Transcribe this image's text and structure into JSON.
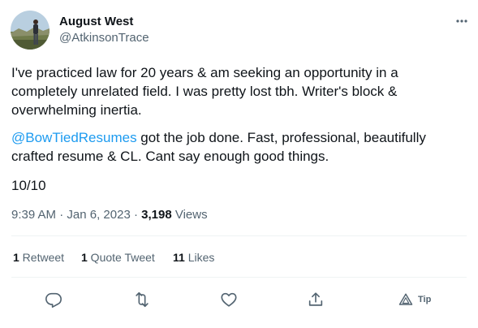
{
  "author": {
    "name": "August West",
    "handle": "@AtkinsonTrace"
  },
  "tweet": {
    "paragraph_1": "I've practiced law for 20 years & am seeking an opportunity in a completely unrelated field. I was pretty lost tbh. Writer's block & overwhelming inertia.",
    "mention": "@BowTiedResumes",
    "paragraph_2_rest": " got the job done. Fast, professional, beautifully crafted resume & CL. Cant say enough good things.",
    "paragraph_3": "10/10"
  },
  "meta": {
    "time": "9:39 AM",
    "separator_1": " · ",
    "date": "Jan 6, 2023",
    "separator_2": " · ",
    "views_count": "3,198",
    "views_label": " Views"
  },
  "stats": {
    "retweets_count": "1",
    "retweets_label": " Retweet",
    "quotes_count": "1",
    "quotes_label": " Quote Tweet",
    "likes_count": "11",
    "likes_label": " Likes"
  },
  "actions": {
    "tip_label": "Tip"
  },
  "icons": {
    "more": "more-horizontal-icon",
    "reply": "reply-icon",
    "retweet": "retweet-icon",
    "like": "heart-icon",
    "share": "share-icon",
    "tip": "tip-icon"
  },
  "colors": {
    "text_primary": "#0f1419",
    "text_secondary": "#536471",
    "link": "#1d9bf0",
    "divider": "#eff3f4"
  }
}
